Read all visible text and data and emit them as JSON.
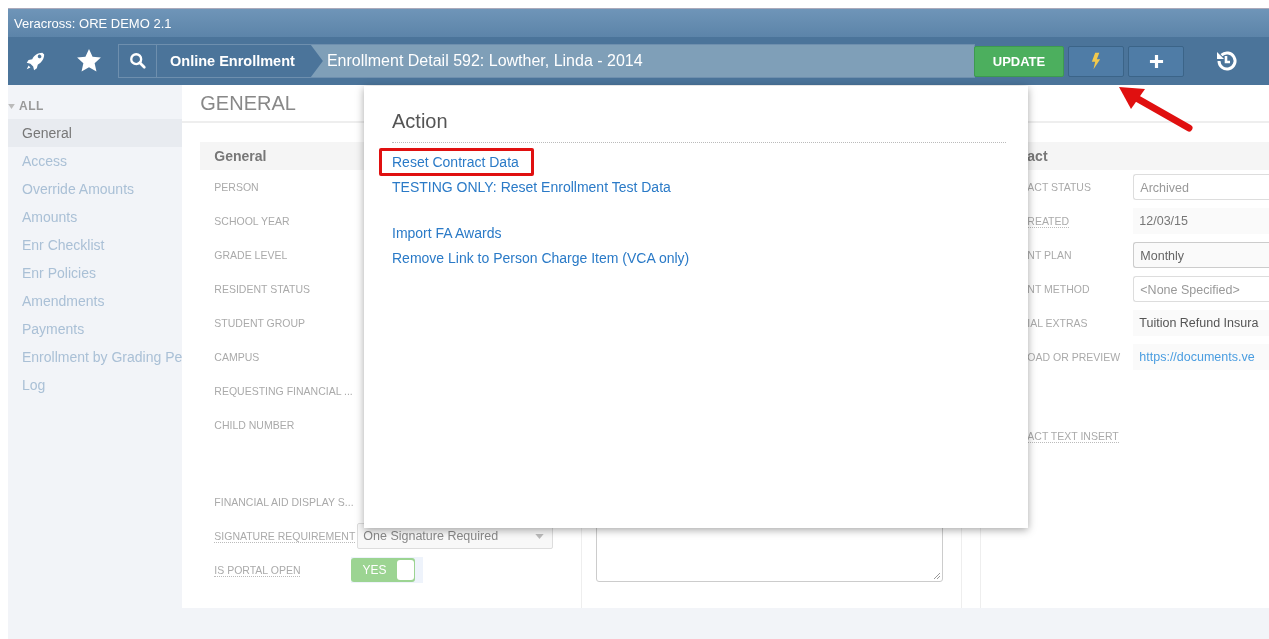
{
  "window": {
    "title": "Veracross: ORE DEMO 2.1"
  },
  "nav": {
    "breadcrumb": "Online Enrollment",
    "page_title": "Enrollment Detail 592: Lowther, Linda - 2014",
    "update_button": "UPDATE"
  },
  "sidebar": {
    "group": "ALL",
    "items": [
      {
        "label": "General",
        "selected": true
      },
      {
        "label": "Access",
        "selected": false
      },
      {
        "label": "Override Amounts",
        "selected": false
      },
      {
        "label": "Amounts",
        "selected": false
      },
      {
        "label": "Enr Checklist",
        "selected": false
      },
      {
        "label": "Enr Policies",
        "selected": false
      },
      {
        "label": "Amendments",
        "selected": false
      },
      {
        "label": "Payments",
        "selected": false
      },
      {
        "label": "Enrollment by Grading Pe",
        "selected": false
      },
      {
        "label": "Log",
        "selected": false
      }
    ]
  },
  "section_title": "GENERAL",
  "left_panel": {
    "title": "General",
    "fields": [
      {
        "label": "PERSON",
        "underlined": false
      },
      {
        "label": "SCHOOL YEAR",
        "underlined": false
      },
      {
        "label": "GRADE LEVEL",
        "underlined": false
      },
      {
        "label": "RESIDENT STATUS",
        "underlined": false
      },
      {
        "label": "STUDENT GROUP",
        "underlined": false
      },
      {
        "label": "CAMPUS",
        "underlined": false
      },
      {
        "label": "REQUESTING FINANCIAL ...",
        "underlined": false
      },
      {
        "label": "CHILD NUMBER",
        "underlined": false
      },
      {
        "label": "FINANCIAL AID DISPLAY S...",
        "underlined": false,
        "gap_before": true
      },
      {
        "label": "SIGNATURE REQUIREMENT",
        "underlined": true,
        "kind": "select",
        "value": "One Signature Required"
      },
      {
        "label": "IS PORTAL OPEN",
        "underlined": true,
        "kind": "toggle",
        "value": "YES",
        "on": true
      }
    ]
  },
  "right_panel": {
    "title": "act",
    "fields": [
      {
        "label": "ACT STATUS",
        "underlined": false,
        "kind": "input",
        "value": "Archived"
      },
      {
        "label": "REATED",
        "underlined": true,
        "kind": "text",
        "value": "12/03/15"
      },
      {
        "label": "NT PLAN",
        "underlined": false,
        "kind": "select",
        "value": "Monthly"
      },
      {
        "label": "NT METHOD",
        "underlined": false,
        "kind": "placeholder",
        "value": "<None Specified>"
      },
      {
        "label": "IAL EXTRAS",
        "underlined": false,
        "kind": "plain",
        "value": "Tuition Refund Insura"
      },
      {
        "label": "OAD OR PREVIEW",
        "underlined": false,
        "kind": "link",
        "value": "https://documents.ve"
      },
      {
        "label": "ACT TEXT INSERT",
        "underlined": true,
        "gap_before": true
      }
    ]
  },
  "action_menu": {
    "title": "Action",
    "groups": [
      [
        {
          "label": "Reset Contract Data",
          "highlighted": true
        },
        {
          "label": "TESTING ONLY: Reset Enrollment Test Data",
          "highlighted": false
        }
      ],
      [
        {
          "label": "Import FA Awards",
          "highlighted": false
        },
        {
          "label": "Remove Link to Person Charge Item (VCA only)",
          "highlighted": false
        }
      ]
    ]
  }
}
